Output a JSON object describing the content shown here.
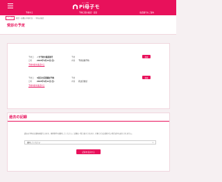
{
  "header": {
    "logo_sub": "ネット予約",
    "logo_text": "Pi母子モ",
    "nav": [
      "予約する",
      "予約日程の確認・変更",
      "電話番号のご案内"
    ]
  },
  "breadcrumb": {
    "home": "トップ",
    "items": [
      "健診・接種の予約状況",
      "予約の確認"
    ]
  },
  "page_title": "予約の確認",
  "section1": {
    "title": "受診の予定",
    "appointments": [
      {
        "label_a": "予約日",
        "value_a": "ノタ予約の確認番号",
        "label_b": "予約",
        "value_b": "",
        "label_c": "日時",
        "value_c": "2023年5月14日(日)",
        "label_d": "内容",
        "value_d": "予防接種予約",
        "link": "予約内容を確認する",
        "button": "変更"
      },
      {
        "label_a": "予約日",
        "value_a": "4回目の定期健診予約",
        "label_b": "予約",
        "value_b": "",
        "label_c": "日時",
        "value_c": "2023年6月11日(日)",
        "label_d": "内容",
        "value_d": "乳幼児健診",
        "link": "予約内容を確認する",
        "button": "変更"
      }
    ]
  },
  "section2": {
    "title": "過去の記録",
    "description": "過去の予約の記録を確認できます。検索条件を選択してください。記録は一覧で表示されます。対象となる記録がない場合は何も表示されません。",
    "select_value": "選択してください",
    "button": "記録を表示する"
  },
  "colors": {
    "primary": "#e8115b",
    "background": "#f6f0f2"
  }
}
